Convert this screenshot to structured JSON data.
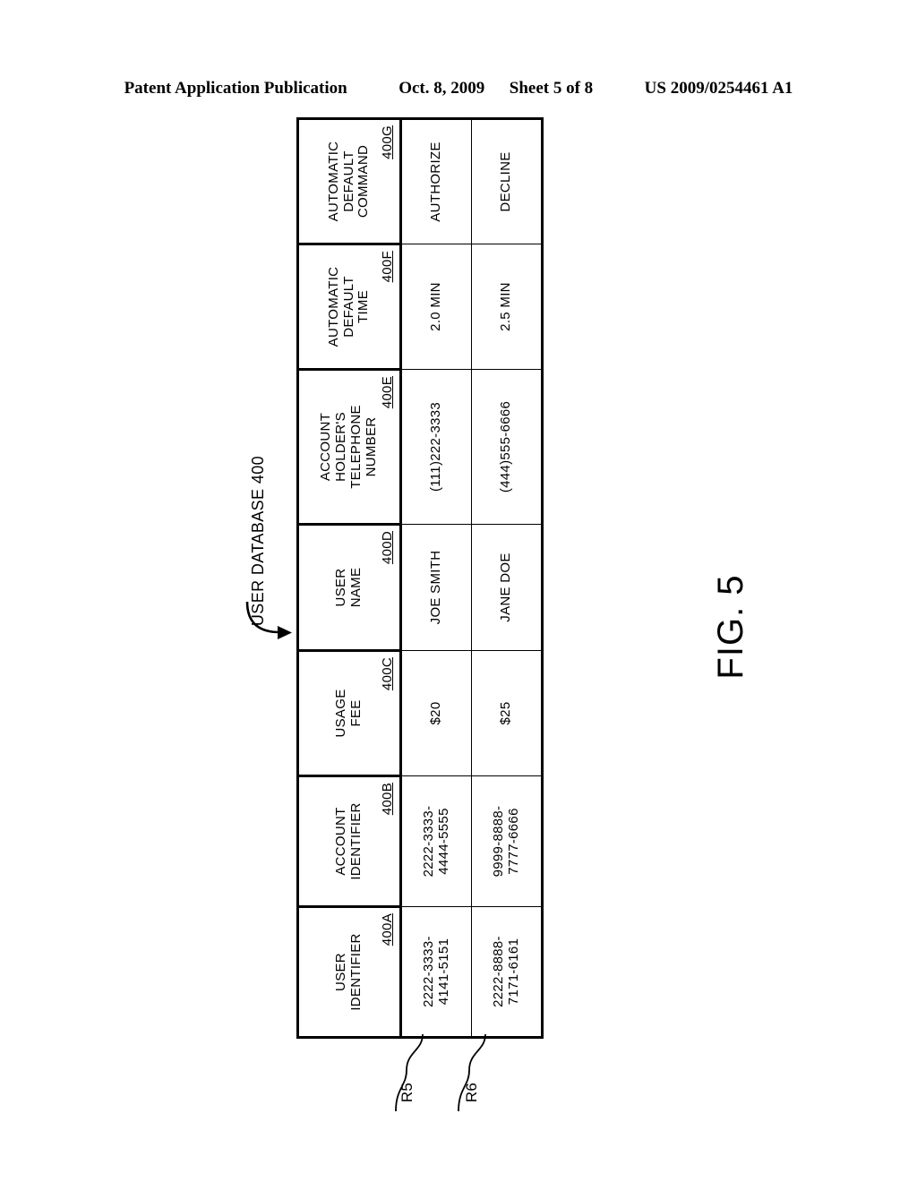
{
  "header": {
    "publication": "Patent Application Publication",
    "date": "Oct. 8, 2009",
    "sheet": "Sheet 5 of 8",
    "patent_number": "US 2009/0254461 A1"
  },
  "figure": {
    "label": "FIG. 5",
    "database_caption": "USER DATABASE 400",
    "arrow_icon": "curved-arrow-right-icon"
  },
  "table": {
    "columns": [
      {
        "title_lines": [
          "USER",
          "IDENTIFIER"
        ],
        "ref": "400A"
      },
      {
        "title_lines": [
          "ACCOUNT",
          "IDENTIFIER"
        ],
        "ref": "400B"
      },
      {
        "title_lines": [
          "USAGE",
          "FEE"
        ],
        "ref": "400C"
      },
      {
        "title_lines": [
          "USER",
          "NAME"
        ],
        "ref": "400D"
      },
      {
        "title_lines": [
          "ACCOUNT",
          "HOLDER'S",
          "TELEPHONE",
          "NUMBER"
        ],
        "ref": "400E"
      },
      {
        "title_lines": [
          "AUTOMATIC",
          "DEFAULT",
          "TIME"
        ],
        "ref": "400F"
      },
      {
        "title_lines": [
          "AUTOMATIC",
          "DEFAULT",
          "COMMAND"
        ],
        "ref": "400G"
      }
    ],
    "rows": [
      {
        "ref": "R5",
        "cells": [
          [
            "2222-3333-",
            "4141-5151"
          ],
          [
            "2222-3333-",
            "4444-5555"
          ],
          [
            "$20"
          ],
          [
            "JOE SMITH"
          ],
          [
            "(111)222-3333"
          ],
          [
            "2.0 MIN"
          ],
          [
            "AUTHORIZE"
          ]
        ]
      },
      {
        "ref": "R6",
        "cells": [
          [
            "2222-8888-",
            "7171-6161"
          ],
          [
            "9999-8888-",
            "7777-6666"
          ],
          [
            "$25"
          ],
          [
            "JANE DOE"
          ],
          [
            "(444)555-6666"
          ],
          [
            "2.5 MIN"
          ],
          [
            "DECLINE"
          ]
        ]
      }
    ]
  },
  "colors": {
    "ink": "#000000",
    "paper": "#ffffff"
  }
}
